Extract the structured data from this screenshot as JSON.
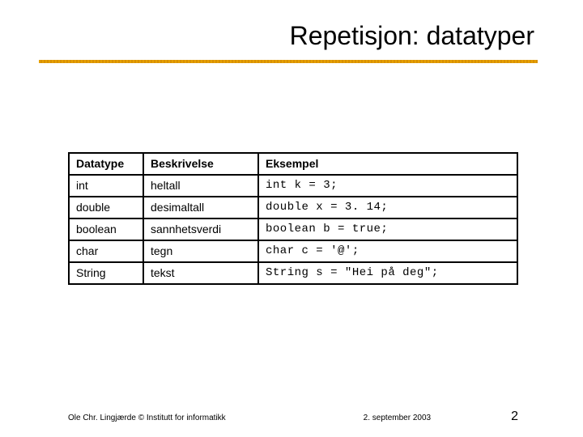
{
  "title": "Repetisjon: datatyper",
  "headers": {
    "datatype": "Datatype",
    "description": "Beskrivelse",
    "example": "Eksempel"
  },
  "rows": [
    {
      "dt": "int",
      "desc": "heltall",
      "ex": "int k = 3;"
    },
    {
      "dt": "double",
      "desc": "desimaltall",
      "ex": "double x = 3. 14;"
    },
    {
      "dt": "boolean",
      "desc": "sannhetsverdi",
      "ex": "boolean b = true;"
    },
    {
      "dt": "char",
      "desc": "tegn",
      "ex": "char c = '@';"
    },
    {
      "dt": "String",
      "desc": "tekst",
      "ex": "String s = \"Hei på deg\";"
    }
  ],
  "footer": {
    "author": "Ole Chr. Lingjærde © Institutt for informatikk",
    "date": "2. september 2003",
    "page": "2"
  }
}
